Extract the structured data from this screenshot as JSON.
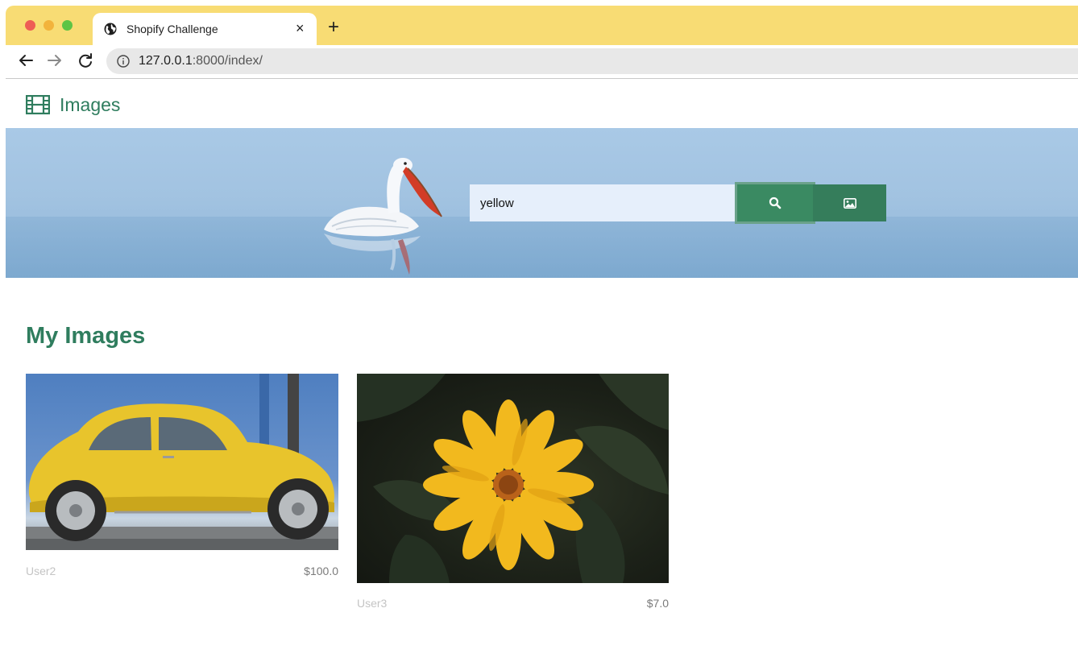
{
  "browser": {
    "tab_title": "Shopify Challenge",
    "new_tab_label": "+",
    "close_label": "×",
    "url_host": "127.0.0.1",
    "url_path": ":8000/index/"
  },
  "header": {
    "brand_icon": "film-icon",
    "brand_label": "Images"
  },
  "search": {
    "value": "yellow",
    "search_icon": "search-icon",
    "image_icon": "image-icon"
  },
  "section": {
    "title": "My Images"
  },
  "images": [
    {
      "user": "User2",
      "price": "$100.0",
      "subject": "yellow-car"
    },
    {
      "user": "User3",
      "price": "$7.0",
      "subject": "yellow-flower"
    }
  ],
  "colors": {
    "accent": "#2f7d5e",
    "tabbar": "#f8dc74",
    "button": "#3a8a62"
  }
}
